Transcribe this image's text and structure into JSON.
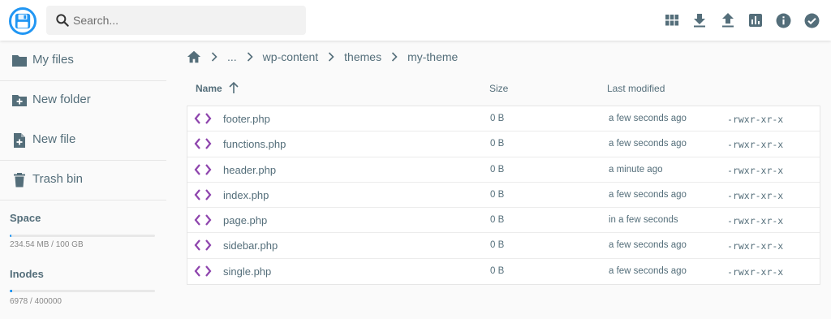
{
  "header": {
    "search_placeholder": "Search...",
    "actions": [
      "grid-view",
      "download",
      "upload",
      "disk-usage",
      "info",
      "select-all"
    ]
  },
  "sidebar": {
    "items": [
      {
        "label": "My files",
        "icon": "folder-icon"
      },
      {
        "label": "New folder",
        "icon": "folder-plus-icon"
      },
      {
        "label": "New file",
        "icon": "file-plus-icon"
      },
      {
        "label": "Trash bin",
        "icon": "trash-icon"
      }
    ],
    "space": {
      "title": "Space",
      "text": "234.54 MB / 100 GB",
      "fraction": 0.0023
    },
    "inodes": {
      "title": "Inodes",
      "text": "6978 / 400000",
      "fraction": 0.0174
    }
  },
  "breadcrumb": {
    "items": [
      "...",
      "wp-content",
      "themes",
      "my-theme"
    ]
  },
  "list": {
    "columns": {
      "name": "Name",
      "size": "Size",
      "modified": "Last modified"
    },
    "files": [
      {
        "name": "footer.php",
        "size": "0 B",
        "modified": "a few seconds ago",
        "perms": "-rwxr-xr-x"
      },
      {
        "name": "functions.php",
        "size": "0 B",
        "modified": "a few seconds ago",
        "perms": "-rwxr-xr-x"
      },
      {
        "name": "header.php",
        "size": "0 B",
        "modified": "a minute ago",
        "perms": "-rwxr-xr-x"
      },
      {
        "name": "index.php",
        "size": "0 B",
        "modified": "a few seconds ago",
        "perms": "-rwxr-xr-x"
      },
      {
        "name": "page.php",
        "size": "0 B",
        "modified": "in a few seconds",
        "perms": "-rwxr-xr-x"
      },
      {
        "name": "sidebar.php",
        "size": "0 B",
        "modified": "a few seconds ago",
        "perms": "-rwxr-xr-x"
      },
      {
        "name": "single.php",
        "size": "0 B",
        "modified": "a few seconds ago",
        "perms": "-rwxr-xr-x"
      }
    ]
  },
  "colors": {
    "accent": "#2196f3",
    "code_icon": "#8e44ad",
    "text": "#546e7a"
  }
}
